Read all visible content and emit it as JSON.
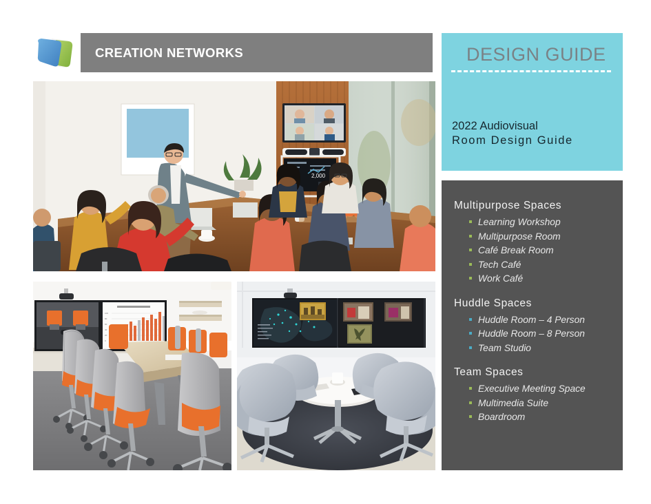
{
  "header": {
    "logo_icon": "creation-networks-logo",
    "title": "CREATION NETWORKS"
  },
  "guide_card": {
    "title": "DESIGN GUIDE",
    "divider": "dashed-rule",
    "subtitle_line1": "2022 Audiovisual",
    "subtitle_line2": "Room Design Guide",
    "bg_color": "#7ed3e0",
    "title_color": "#7a8286"
  },
  "spaces_panel": {
    "bg_color": "#545454",
    "groups": [
      {
        "title": "Multipurpose Spaces",
        "bullet_color": "#9bbb59",
        "bullet_class": "b-green",
        "items": [
          "Learning Workshop",
          "Multipurpose Room",
          "Café Break Room",
          "Tech Café",
          "Work Café"
        ]
      },
      {
        "title": "Huddle Spaces",
        "bullet_color": "#4bacc6",
        "bullet_class": "b-blue",
        "items": [
          "Huddle Room – 4 Person",
          "Huddle Room – 8 Person",
          "Team Studio"
        ]
      },
      {
        "title": "Team Spaces",
        "bullet_color": "#9bbb59",
        "bullet_class": "b-green",
        "items": [
          "Executive Meeting Space",
          "Multimedia Suite",
          "Boardroom"
        ]
      }
    ]
  },
  "photos": [
    {
      "name": "photo-multipurpose-conference-room",
      "caption": "People seated at a large wood conference table with a presenter pointing at a wall-mounted video conference display showing remote participants"
    },
    {
      "name": "photo-boardroom-orange-chairs",
      "caption": "Boardroom with orange and grey task chairs along a light wood table facing dual displays, one showing a video feed and one showing a bar chart"
    },
    {
      "name": "photo-huddle-room-lounge",
      "caption": "Huddle space with four grey lounge chairs around a round white table on a dark rug facing a wide video wall"
    }
  ]
}
